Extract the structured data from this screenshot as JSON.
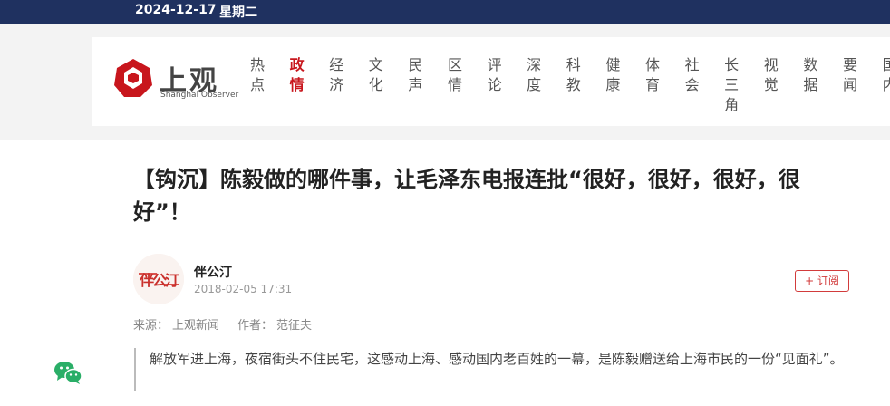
{
  "topbar": {
    "date": "2024-12-17",
    "weekday": "星期二"
  },
  "logo": {
    "name_cn": "上观",
    "name_en": "Shanghai Observer",
    "brand_color": "#c8161d"
  },
  "nav": {
    "active_index": 1,
    "items": [
      {
        "label": "热点",
        "chars": [
          "热",
          "点"
        ]
      },
      {
        "label": "政情",
        "chars": [
          "政",
          "情"
        ]
      },
      {
        "label": "经济",
        "chars": [
          "经",
          "济"
        ]
      },
      {
        "label": "文化",
        "chars": [
          "文",
          "化"
        ]
      },
      {
        "label": "民声",
        "chars": [
          "民",
          "声"
        ]
      },
      {
        "label": "区情",
        "chars": [
          "区",
          "情"
        ]
      },
      {
        "label": "评论",
        "chars": [
          "评",
          "论"
        ]
      },
      {
        "label": "深度",
        "chars": [
          "深",
          "度"
        ]
      },
      {
        "label": "科教",
        "chars": [
          "科",
          "教"
        ]
      },
      {
        "label": "健康",
        "chars": [
          "健",
          "康"
        ]
      },
      {
        "label": "体育",
        "chars": [
          "体",
          "育"
        ]
      },
      {
        "label": "社会",
        "chars": [
          "社",
          "会"
        ]
      },
      {
        "label": "长三角",
        "chars": [
          "长",
          "三",
          "角"
        ]
      },
      {
        "label": "视觉",
        "chars": [
          "视",
          "觉"
        ]
      },
      {
        "label": "数据",
        "chars": [
          "数",
          "据"
        ]
      },
      {
        "label": "要闻",
        "chars": [
          "要",
          "闻"
        ]
      },
      {
        "label": "国内",
        "chars": [
          "国",
          "内"
        ]
      }
    ]
  },
  "article": {
    "title": "【钩沉】陈毅做的哪件事，让毛泽东电报连批“很好，很好，很好，很好”！",
    "author": "伴公汀",
    "avatar_text": "伴公汀",
    "publish_time": "2018-02-05 17:31",
    "follow_label": "+ 订阅",
    "source_label": "来源：",
    "source": "上观新闻",
    "writer_label": "作者：",
    "writer": "范征夫",
    "lead": "解放军进上海，夜宿街头不住民宅，这感动上海、感动国内老百姓的一幕，是陈毅赠送给上海市民的一份“见面礼”。"
  },
  "wechat": {
    "icon": "wechat-icon",
    "color": "#2aae67"
  }
}
